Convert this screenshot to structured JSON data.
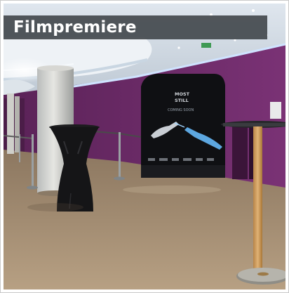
{
  "caption": {
    "title": "Filmpremiere"
  },
  "photo": {
    "subject": "event-hall",
    "banner": {
      "line1": "MOST",
      "line2": "STILL",
      "tagline": "COMING SOON"
    }
  },
  "colors": {
    "caption_bg": "#40464a",
    "caption_text": "#ffffff",
    "wall": "#6d2a68",
    "floor": "#a69176",
    "ceiling": "#e8eef4"
  }
}
